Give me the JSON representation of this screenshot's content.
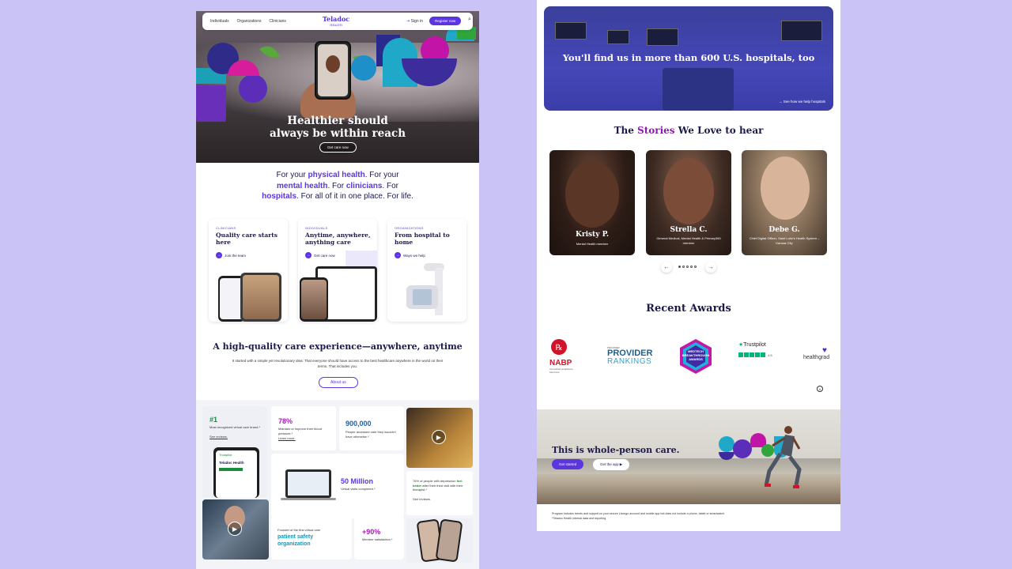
{
  "nav": {
    "links": [
      "Individuals",
      "Organizations",
      "Clinicians"
    ],
    "logo": "Teladoc",
    "logo_sub": "HEALTH",
    "sign_in": "Sign in",
    "register": "Register now"
  },
  "hero": {
    "line1": "Healthier should",
    "line2": "always be within reach",
    "cta": "Get care now"
  },
  "tagline": {
    "p1": "For your ",
    "b1": "physical health",
    "p2": ". For your",
    "b2": "mental health",
    "p3": ". For ",
    "b3": "clinicians",
    "p4": ". For",
    "b4": "hospitals",
    "p5": ". For all of it in one place. For life."
  },
  "cards": [
    {
      "category": "CLINICIANS",
      "title": "Quality care starts here",
      "action": "Join the team"
    },
    {
      "category": "INDIVIDUALS",
      "title": "Anytime, anywhere, anything care",
      "action": "Get care now"
    },
    {
      "category": "ORGANIZATIONS",
      "title": "From hospital to home",
      "action": "Ways we help"
    }
  ],
  "care": {
    "heading": "A high-quality care experience—anywhere, anytime",
    "body": "It started with a simple yet revolutionary idea: That everyone should have access to the best healthcare anywhere in the world on their terms. That includes you.",
    "button": "About us"
  },
  "stats": {
    "s1_big": "#1",
    "s1_text": "Most recognized virtual care brand.*",
    "s1_link": "See reviews.",
    "s1_trust": "Trustpilot",
    "s1_app": "Teladoc Health",
    "s2_big": "78%",
    "s2_text": "Maintain or improve their blood pressure.*",
    "s2_link": "Learn more.",
    "s3_big": "900,000",
    "s3_text": "People accessed care they wouldn't have otherwise.*",
    "s4_big": "50 Million",
    "s4_text": "Virtual visits completed.*",
    "s5_pre": "76% of people with depression ",
    "s5_hl": "feel better",
    "s5_post": " after their third visit with their therapist.*",
    "s5_link": "See reviews.",
    "s6_small": "Founder of the first virtual care",
    "s6_big": "patient safety organization",
    "s7_big": "+90%",
    "s7_text": "Member satisfaction.*"
  },
  "hospitals": {
    "title": "You'll find us in more than 600 U.S. hospitals, too",
    "link": "See how we help hospitals"
  },
  "stories": {
    "pre": "The ",
    "hl": "Stories",
    "post": " We Love to hear",
    "people": [
      {
        "name": "Kristy P.",
        "role": "Mental Health member"
      },
      {
        "name": "Strella C.",
        "role": "General Medical, Mental Health & Primary360 member"
      },
      {
        "name": "Debe G.",
        "role": "Chief Digital Officer, Saint Luke's Health System – Kansas City"
      }
    ]
  },
  "awards": {
    "title": "Recent Awards",
    "nabp": "NABP",
    "nabp_sub": "Accredited Healthcare Merchant",
    "provider_small": "PROVIDER",
    "provider_big": "PROVIDER",
    "provider_sub": "RANKINGS",
    "medtech_1": "MEDTECH",
    "medtech_2": "BREAKTHROUGH",
    "medtech_3": "AWARDS",
    "trustpilot": "Trustpilot",
    "trust_score": "4.8",
    "healthgrades": "healthgrad"
  },
  "whole": {
    "title": "This is whole-person care.",
    "get_started": "Get started",
    "get_app": "Get the app"
  },
  "footnotes": [
    "Program includes trends and support on your secure Livongo account and mobile app but does not include a phone, tablet or smartwatch.",
    "*Teladoc Health internal data and reporting."
  ],
  "colors": {
    "brand_purple": "#5b35e0",
    "navy": "#1c1a4b",
    "magenta": "#8c1aad",
    "background": "#c9c4f5"
  }
}
